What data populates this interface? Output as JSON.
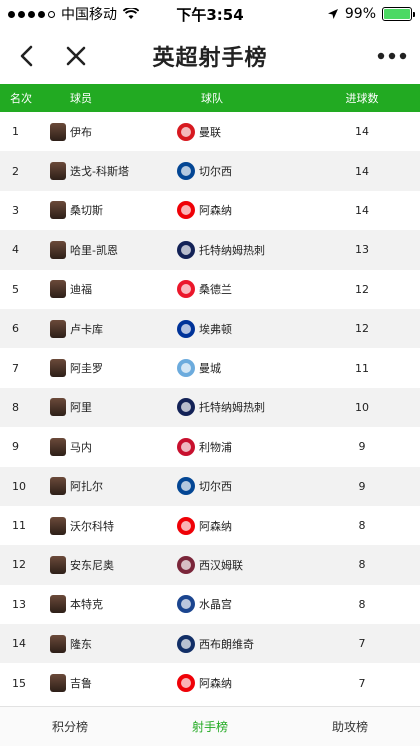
{
  "status_bar": {
    "carrier": "中国移动",
    "time": "下午3:54",
    "battery": "99%",
    "battery_level": 0.99,
    "icons": [
      "signal-dots-icon",
      "wifi-icon",
      "location-arrow-icon",
      "battery-icon"
    ]
  },
  "nav": {
    "title": "英超射手榜",
    "icons": [
      "back-chevron-icon",
      "close-x-icon",
      "more-dots-icon"
    ]
  },
  "table": {
    "headers": {
      "rank": "名次",
      "player": "球员",
      "team": "球队",
      "goals": "进球数"
    },
    "rows": [
      {
        "rank": "1",
        "player": "伊布",
        "team": "曼联",
        "goals": "14",
        "crest_color": "#d71920"
      },
      {
        "rank": "2",
        "player": "迭戈-科斯塔",
        "team": "切尔西",
        "goals": "14",
        "crest_color": "#034694"
      },
      {
        "rank": "3",
        "player": "桑切斯",
        "team": "阿森纳",
        "goals": "14",
        "crest_color": "#ef0107"
      },
      {
        "rank": "4",
        "player": "哈里-凯恩",
        "team": "托特纳姆热刺",
        "goals": "13",
        "crest_color": "#132257"
      },
      {
        "rank": "5",
        "player": "迪福",
        "team": "桑德兰",
        "goals": "12",
        "crest_color": "#eb172b"
      },
      {
        "rank": "6",
        "player": "卢卡库",
        "team": "埃弗顿",
        "goals": "12",
        "crest_color": "#003399"
      },
      {
        "rank": "7",
        "player": "阿圭罗",
        "team": "曼城",
        "goals": "11",
        "crest_color": "#6cabdd"
      },
      {
        "rank": "8",
        "player": "阿里",
        "team": "托特纳姆热刺",
        "goals": "10",
        "crest_color": "#132257"
      },
      {
        "rank": "9",
        "player": "马内",
        "team": "利物浦",
        "goals": "9",
        "crest_color": "#c8102e"
      },
      {
        "rank": "10",
        "player": "阿扎尔",
        "team": "切尔西",
        "goals": "9",
        "crest_color": "#034694"
      },
      {
        "rank": "11",
        "player": "沃尔科特",
        "team": "阿森纳",
        "goals": "8",
        "crest_color": "#ef0107"
      },
      {
        "rank": "12",
        "player": "安东尼奥",
        "team": "西汉姆联",
        "goals": "8",
        "crest_color": "#7a263a"
      },
      {
        "rank": "13",
        "player": "本特克",
        "team": "水晶宫",
        "goals": "8",
        "crest_color": "#1b458f"
      },
      {
        "rank": "14",
        "player": "隆东",
        "team": "西布朗维奇",
        "goals": "7",
        "crest_color": "#122f67"
      },
      {
        "rank": "15",
        "player": "吉鲁",
        "team": "阿森纳",
        "goals": "7",
        "crest_color": "#ef0107"
      }
    ]
  },
  "tabs": [
    {
      "label": "积分榜",
      "active": false
    },
    {
      "label": "射手榜",
      "active": true
    },
    {
      "label": "助攻榜",
      "active": false
    }
  ],
  "colors": {
    "accent": "#22aa22",
    "row_alt": "#f2f2f2",
    "battery": "#4cd964"
  }
}
